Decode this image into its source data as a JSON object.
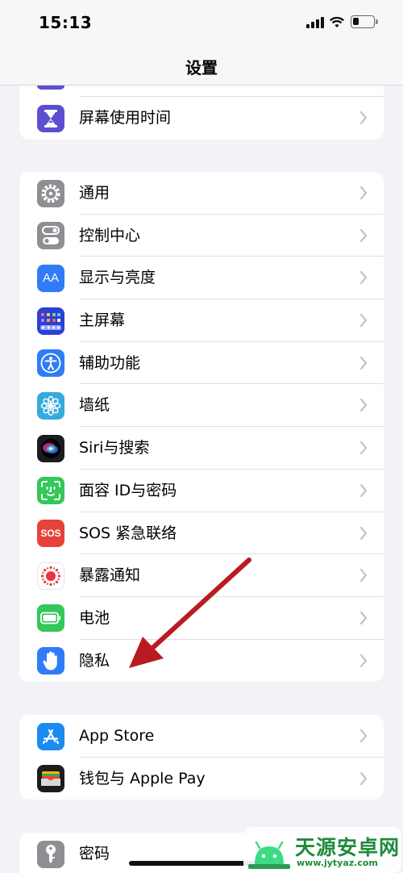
{
  "status_bar": {
    "time": "15:13",
    "icons": [
      "cellular-signal-icon",
      "wifi-icon",
      "battery-icon"
    ]
  },
  "nav": {
    "title": "设置"
  },
  "groups": [
    {
      "items": [
        {
          "label": "屏幕使用时间",
          "icon": "hourglass-icon",
          "color": "#5856d6"
        }
      ]
    },
    {
      "items": [
        {
          "label": "通用",
          "icon": "gear-icon",
          "color": "#8e8e93"
        },
        {
          "label": "控制中心",
          "icon": "toggle-icon",
          "color": "#8e8e93"
        },
        {
          "label": "显示与亮度",
          "icon": "text-size-icon",
          "color": "#2f7cf6",
          "icon_text": "AA"
        },
        {
          "label": "主屏幕",
          "icon": "home-grid-icon",
          "color": "#2c3fd6"
        },
        {
          "label": "辅助功能",
          "icon": "accessibility-icon",
          "color": "#2f7cf6"
        },
        {
          "label": "墙纸",
          "icon": "flower-icon",
          "color": "#37aadc"
        },
        {
          "label": "Siri与搜索",
          "icon": "siri-icon",
          "color": "#1c1c1e"
        },
        {
          "label": "面容 ID与密码",
          "icon": "face-id-icon",
          "color": "#34c759"
        },
        {
          "label": "SOS 紧急联络",
          "icon": "sos-icon",
          "color": "#e5433a",
          "icon_text": "SOS"
        },
        {
          "label": "暴露通知",
          "icon": "exposure-icon",
          "color": "#ffffff"
        },
        {
          "label": "电池",
          "icon": "battery-icon",
          "color": "#34c759"
        },
        {
          "label": "隐私",
          "icon": "hand-icon",
          "color": "#2f7cf6"
        }
      ]
    },
    {
      "items": [
        {
          "label": "App Store",
          "icon": "app-store-icon",
          "color": "#1a8cf0"
        },
        {
          "label": "钱包与 Apple Pay",
          "icon": "wallet-icon",
          "color": "#1c1c1e"
        }
      ]
    },
    {
      "items": [
        {
          "label": "密码",
          "icon": "key-icon",
          "color": "#8e8e93"
        }
      ]
    }
  ],
  "annotation": {
    "arrow_color": "#b81c22"
  },
  "watermark": {
    "title": "天源安卓网",
    "url": "www.jytyaz.com"
  }
}
